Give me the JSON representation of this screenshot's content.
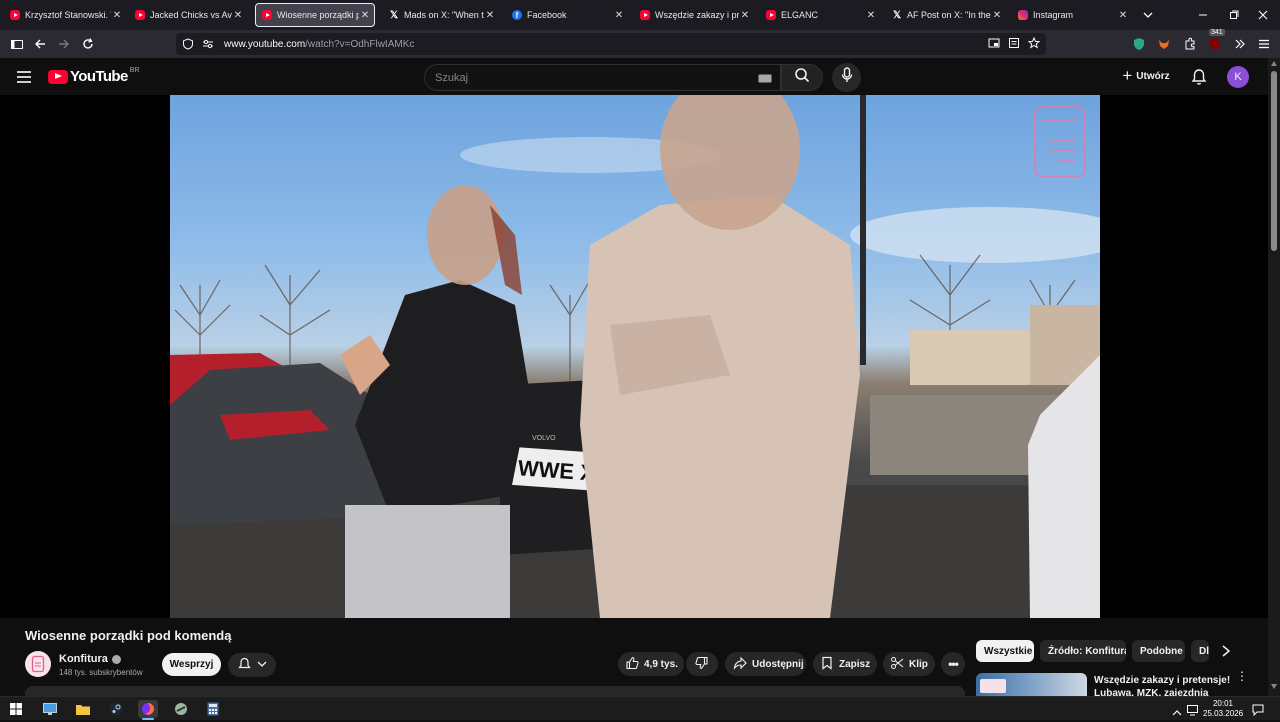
{
  "browser": {
    "tabs": [
      {
        "label": "Krzysztof Stanowski. W ja",
        "icon": "youtube-icon",
        "active": false
      },
      {
        "label": "Jacked Chicks vs Average",
        "icon": "youtube-icon",
        "active": false
      },
      {
        "label": "Wiosenne porządki p",
        "icon": "youtube-icon",
        "active": true
      },
      {
        "label": "Mads on X: \"When th",
        "icon": "x-icon",
        "active": false
      },
      {
        "label": "Facebook",
        "icon": "facebook-icon",
        "active": false
      },
      {
        "label": "Wszędzie zakazy i preten",
        "icon": "youtube-icon",
        "active": false
      },
      {
        "label": "ELGANC",
        "icon": "youtube-icon",
        "active": false
      },
      {
        "label": "AF Post on X: \"In the first",
        "icon": "x-icon",
        "active": false
      },
      {
        "label": "Instagram",
        "icon": "instagram-icon",
        "active": false
      }
    ],
    "url_host": "www.youtube.com",
    "url_path": "/watch?v=OdhFlwIAMKc",
    "extension_badge": "341"
  },
  "youtube": {
    "logo_text": "YouTube",
    "country_code": "BR",
    "search_placeholder": "Szukaj",
    "create_label": "Utwórz",
    "avatar_letter": "K",
    "avatar_color": "#8a4fd6"
  },
  "video": {
    "title": "Wiosenne porządki pod komendą",
    "license_plate": "WWE XS52",
    "car_badge": "VOLVO"
  },
  "channel": {
    "name": "Konfitura",
    "subscribers": "148 tys. subskrybentów",
    "support_label": "Wesprzyj"
  },
  "actions": {
    "likes": "4,9 tys.",
    "share_label": "Udostępnij",
    "save_label": "Zapisz",
    "clip_label": "Klip"
  },
  "related": {
    "chips": [
      "Wszystkie",
      "Źródło: Konfitura",
      "Podobne",
      "Dla"
    ],
    "first_title_line1": "Wszędzie zakazy i pretensje!",
    "first_title_line2": "Lubawa, MZK, zajezdnia"
  },
  "taskbar": {
    "time": "20:01",
    "date": "25.03.2026"
  }
}
